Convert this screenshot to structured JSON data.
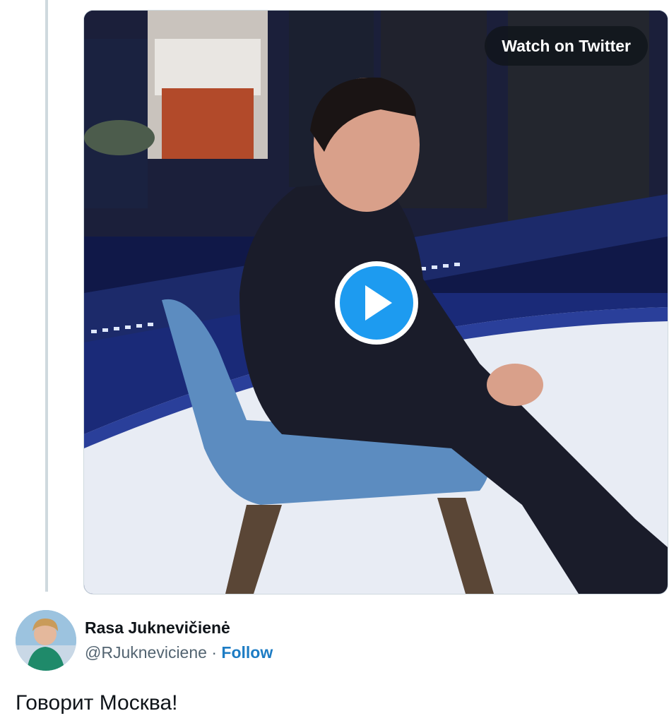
{
  "media": {
    "watch_label": "Watch on Twitter",
    "play_icon": "play-icon",
    "colors": {
      "play_circle": "#1d9bf0",
      "overlay": "#0f1419"
    }
  },
  "author": {
    "display_name": "Rasa Juknevičienė",
    "handle": "@RJukneviciene",
    "separator": "·",
    "follow_label": "Follow"
  },
  "tweet": {
    "text": "Говорит Москва!"
  },
  "colors": {
    "accent": "#1d7cc4",
    "secondary_text": "#536471",
    "thread_line": "#cfd9de"
  }
}
